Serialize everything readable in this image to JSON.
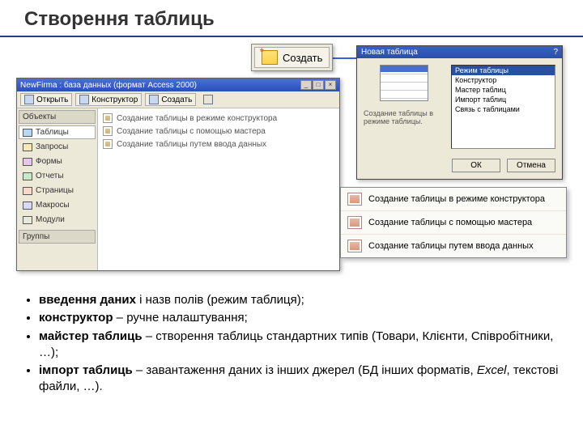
{
  "title": "Створення таблиць",
  "create_button": {
    "label": "Создать"
  },
  "db_window": {
    "title": "NewFirma : база данных (формат Access 2000)",
    "toolbar": {
      "open": "Открыть",
      "design": "Конструктор",
      "new": "Создать"
    },
    "sidebar": {
      "header": "Объекты",
      "items": [
        {
          "label": "Таблицы"
        },
        {
          "label": "Запросы"
        },
        {
          "label": "Формы"
        },
        {
          "label": "Отчеты"
        },
        {
          "label": "Страницы"
        },
        {
          "label": "Макросы"
        },
        {
          "label": "Модули"
        }
      ],
      "footer": "Группы"
    },
    "main_items": [
      "Создание таблицы в режиме конструктора",
      "Создание таблицы с помощью мастера",
      "Создание таблицы путем ввода данных"
    ]
  },
  "new_table": {
    "title": "Новая таблица",
    "desc": "Создание таблицы в режиме таблицы.",
    "options": [
      "Режим таблицы",
      "Конструктор",
      "Мастер таблиц",
      "Импорт таблиц",
      "Связь с таблицами"
    ],
    "ok": "ОК",
    "cancel": "Отмена",
    "help_icon": "?"
  },
  "callout_items": [
    "Создание таблицы в режиме конструктора",
    "Создание таблицы с помощью мастера",
    "Создание таблицы путем ввода данных"
  ],
  "bullets": [
    {
      "strong": "введення даних",
      "rest": " і назв полів (режим таблиця);"
    },
    {
      "strong": "конструктор",
      "rest": " – ручне налаштування;"
    },
    {
      "strong": "майстер таблиць",
      "rest": " – створення таблиць стандартних типів (Товари, Клієнти, Співробітники, …);"
    },
    {
      "strong": "імпорт таблиць",
      "rest": " – завантаження даних із інших джерел (БД інших форматів, ",
      "ital": "Excel",
      "rest2": ", текстові файли, …)."
    }
  ]
}
